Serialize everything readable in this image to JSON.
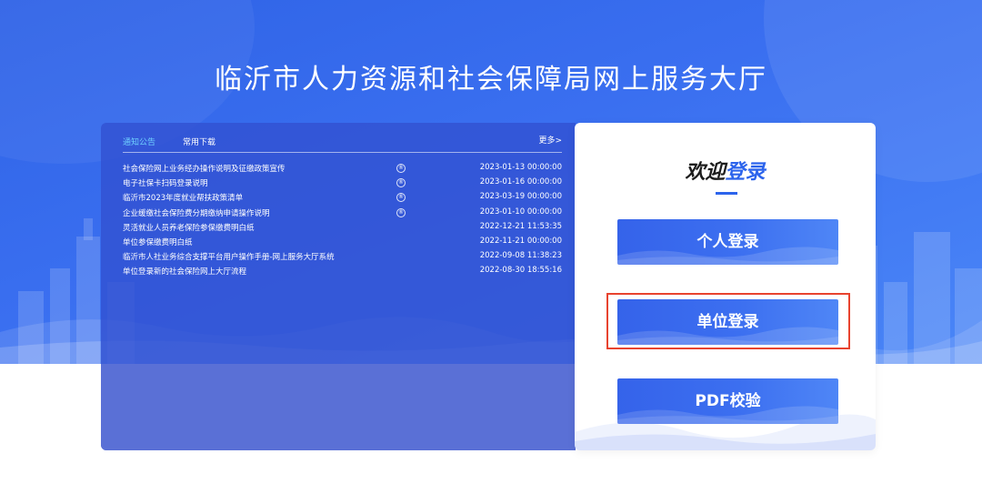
{
  "page": {
    "title": "临沂市人力资源和社会保障局网上服务大厅"
  },
  "colors": {
    "hero_blue": "#3a6ff0",
    "panel_blue": "#3252d2",
    "accent_blue": "#2c64ec",
    "active_tab": "#6fd0ff",
    "highlight_red": "#e8432f"
  },
  "notices": {
    "tabs": [
      {
        "label": "通知公告",
        "active": true
      },
      {
        "label": "常用下载",
        "active": false
      }
    ],
    "more_label": "更多>",
    "badge_icon": "info-circle-icon",
    "items": [
      {
        "title": "社会保险网上业务经办操作说明及征缴政策宣传",
        "date": "2023-01-13 00:00:00",
        "badge": "®"
      },
      {
        "title": "电子社保卡扫码登录说明",
        "date": "2023-01-16 00:00:00",
        "badge": "®"
      },
      {
        "title": "临沂市2023年度就业帮扶政策清单",
        "date": "2023-03-19 00:00:00",
        "badge": "®"
      },
      {
        "title": "企业缓缴社会保险费分期缴纳申请操作说明",
        "date": "2023-01-10 00:00:00",
        "badge": "®"
      },
      {
        "title": "灵活就业人员养老保险参保缴费明白纸",
        "date": "2022-12-21 11:53:35"
      },
      {
        "title": "单位参保缴费明白纸",
        "date": "2022-11-21 00:00:00"
      },
      {
        "title": "临沂市人社业务综合支撑平台用户操作手册-网上服务大厅系统",
        "date": "2022-09-08 11:38:23"
      },
      {
        "title": "单位登录新的社会保险网上大厅流程",
        "date": "2022-08-30 18:55:16"
      }
    ]
  },
  "login": {
    "welcome_part1": "欢迎",
    "welcome_part2": "登录",
    "personal_label": "个人登录",
    "unit_label": "单位登录",
    "pdf_label": "PDF校验"
  }
}
